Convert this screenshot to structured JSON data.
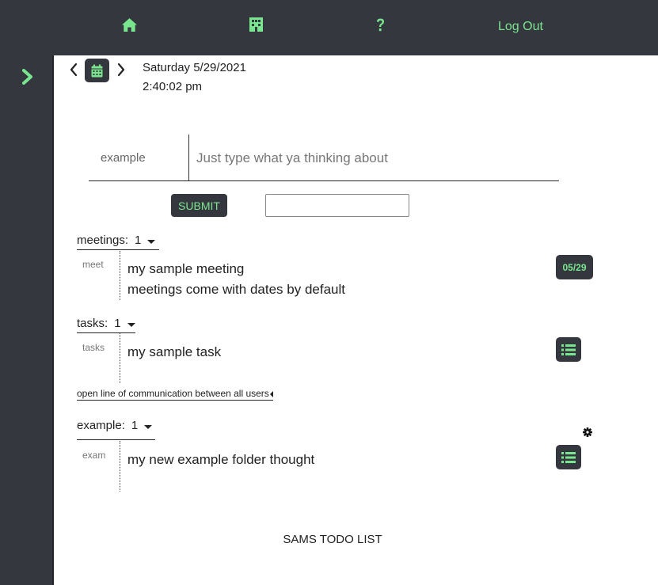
{
  "colors": {
    "nav_bg": "#34373e",
    "accent": "#7ae58f",
    "text": "#222222"
  },
  "topnav": {
    "items": [
      {
        "icon": "home-icon"
      },
      {
        "icon": "building-icon"
      },
      {
        "icon": "help-icon"
      }
    ],
    "logout_label": "Log Out"
  },
  "sidebar": {
    "toggle_icon": "chevron-right-icon"
  },
  "date_header": {
    "prev_icon": "chevron-left-icon",
    "calendar_icon": "calendar-icon",
    "next_icon": "chevron-right-icon",
    "date": "Saturday 5/29/2021",
    "time": "2:40:02 pm"
  },
  "composer": {
    "folder_label": "example",
    "placeholder": "Just type what ya thinking about",
    "submit_label": "SUBMIT",
    "secondary_value": ""
  },
  "folders": [
    {
      "name": "meetings:",
      "count": "1",
      "row_label": "meet",
      "lines": [
        "my sample meeting",
        "meetings come with dates by default"
      ],
      "badge": "05/29"
    },
    {
      "name": "tasks:",
      "count": "1",
      "row_label": "tasks",
      "lines": [
        "my sample task"
      ],
      "badge_icon": "list-icon"
    },
    {
      "name": "example:",
      "count": "1",
      "row_label": "exam",
      "lines": [
        "my new example folder thought"
      ],
      "badge_icon": "list-icon"
    }
  ],
  "communication_link": "open line of communication between all users",
  "footer": "SAMS TODO LIST"
}
